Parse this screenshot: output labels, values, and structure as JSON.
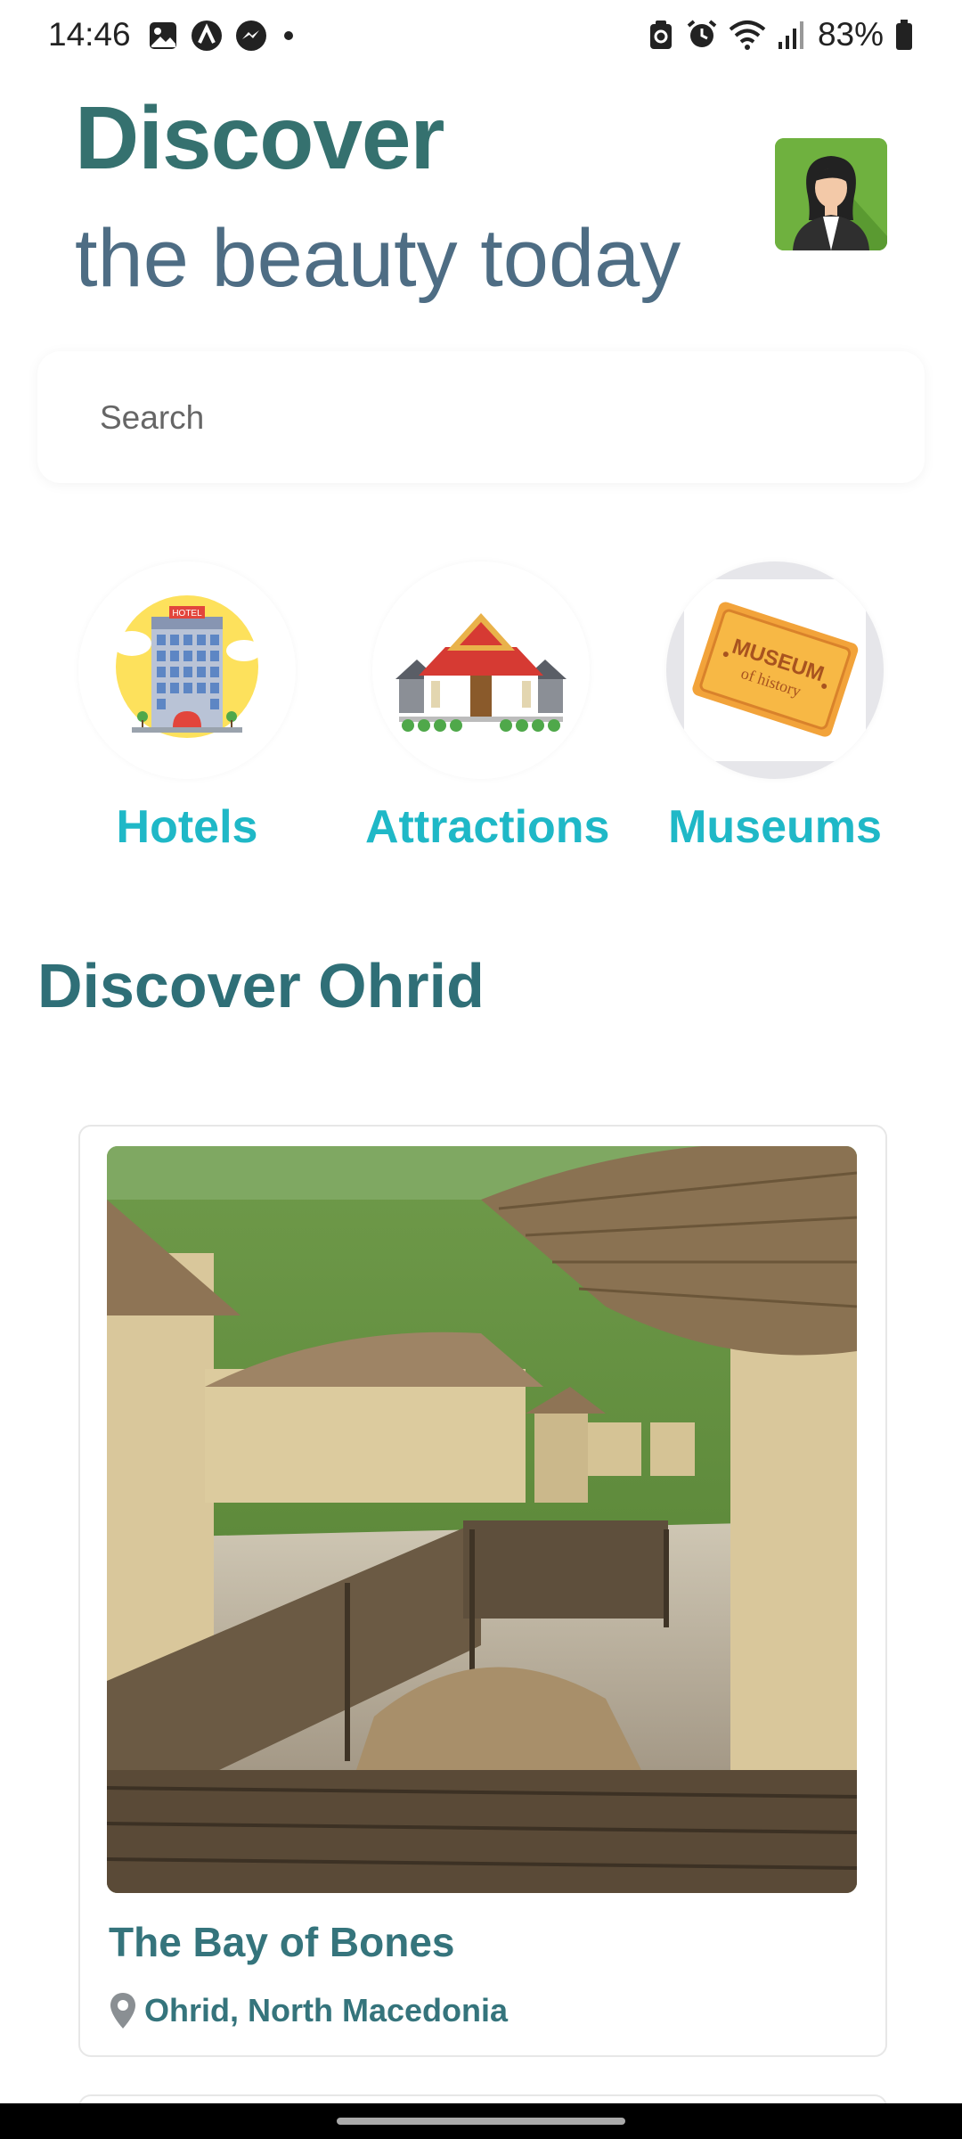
{
  "status": {
    "time": "14:46",
    "battery": "83%",
    "left_icons": [
      "gallery-icon",
      "app-icon",
      "messenger-icon",
      "dot-icon"
    ],
    "right_icons": [
      "recycle-icon",
      "alarm-icon",
      "wifi-icon",
      "signal-icon",
      "battery-icon"
    ]
  },
  "header": {
    "title": "Discover",
    "subtitle": "the beauty today"
  },
  "search": {
    "placeholder": "Search"
  },
  "categories": [
    {
      "label": "Hotels",
      "icon": "hotel-icon"
    },
    {
      "label": "Attractions",
      "icon": "temple-icon"
    },
    {
      "label": "Museums",
      "icon": "museum-ticket-icon"
    }
  ],
  "section": {
    "title": "Discover Ohrid"
  },
  "cards": [
    {
      "title": "The Bay of Bones",
      "location": "Ohrid, North Macedonia"
    }
  ],
  "colors": {
    "title": "#35716f",
    "subtitle": "#4e6d84",
    "category_label": "#1fb8c7",
    "card_text": "#35747c"
  }
}
